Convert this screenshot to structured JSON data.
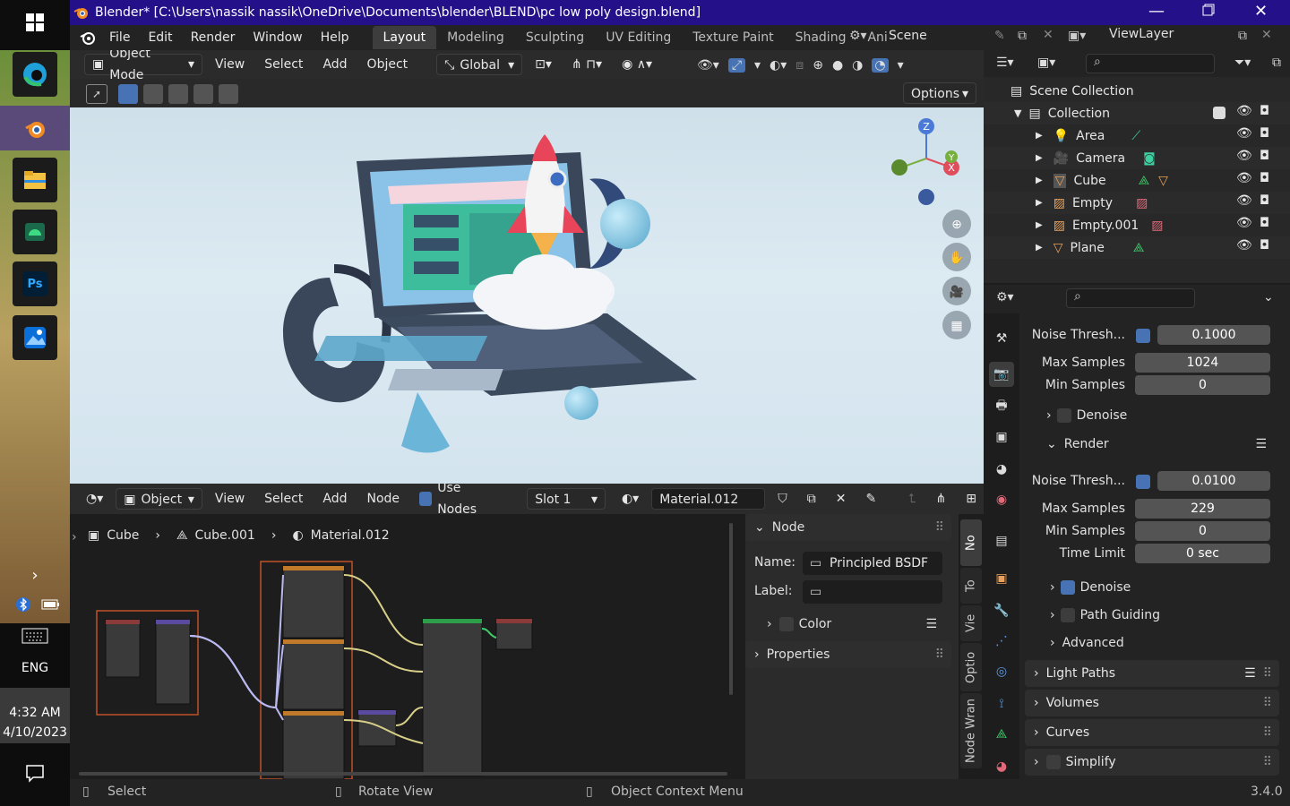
{
  "window": {
    "title": "Blender* [C:\\Users\\nassik nassik\\OneDrive\\Documents\\blender\\BLEND\\pc low poly design.blend]"
  },
  "taskbar": {
    "time": "4:32 AM",
    "date": "4/10/2023",
    "lang": "ENG",
    "apps": [
      "edge-icon",
      "blender-icon",
      "file-explorer-icon",
      "android-studio-icon",
      "photoshop-icon",
      "photos-icon"
    ]
  },
  "menu": {
    "items": [
      "File",
      "Edit",
      "Render",
      "Window",
      "Help"
    ]
  },
  "workspaces": [
    "Layout",
    "Modeling",
    "Sculpting",
    "UV Editing",
    "Texture Paint",
    "Shading",
    "Ani"
  ],
  "scene": {
    "name": "Scene",
    "view_layer": "ViewLayer"
  },
  "viewport": {
    "mode": "Object Mode",
    "menus": [
      "View",
      "Select",
      "Add",
      "Object"
    ],
    "transform": "Global",
    "options_label": "Options",
    "gizmo_labels": {
      "z": "Z",
      "x": "X",
      "y": "Y"
    }
  },
  "node_editor": {
    "type": "Object",
    "menus": [
      "View",
      "Select",
      "Add",
      "Node"
    ],
    "use_nodes_label": "Use Nodes",
    "slot": "Slot 1",
    "material": "Material.012",
    "breadcrumb": [
      "Cube",
      "Cube.001",
      "Material.012"
    ],
    "panel": {
      "node_title": "Node",
      "name_label": "Name:",
      "name_value": "Principled BSDF",
      "label_label": "Label:",
      "color_label": "Color",
      "properties_label": "Properties"
    },
    "side_tabs": [
      "No",
      "To",
      "Vie",
      "Optio",
      "Node Wran"
    ]
  },
  "outliner": {
    "root": "Scene Collection",
    "collection": "Collection",
    "items": [
      "Area",
      "Camera",
      "Cube",
      "Empty",
      "Empty.001",
      "Plane"
    ]
  },
  "properties": {
    "viewport_noise_label": "Noise Thresh...",
    "viewport_noise_value": "0.1000",
    "viewport_max_samples_label": "Max Samples",
    "viewport_max_samples": "1024",
    "viewport_min_samples_label": "Min Samples",
    "viewport_min_samples": "0",
    "denoise_label": "Denoise",
    "render_label": "Render",
    "render_noise_label": "Noise Thresh...",
    "render_noise_value": "0.0100",
    "render_max_samples_label": "Max Samples",
    "render_max_samples": "229",
    "render_min_samples_label": "Min Samples",
    "render_min_samples": "0",
    "time_limit_label": "Time Limit",
    "time_limit": "0 sec",
    "render_denoise_label": "Denoise",
    "path_guiding_label": "Path Guiding",
    "advanced_label": "Advanced",
    "light_paths_label": "Light Paths",
    "volumes_label": "Volumes",
    "curves_label": "Curves",
    "simplify_label": "Simplify"
  },
  "status": {
    "select": "Select",
    "rotate": "Rotate View",
    "context": "Object Context Menu",
    "version": "3.4.0"
  }
}
